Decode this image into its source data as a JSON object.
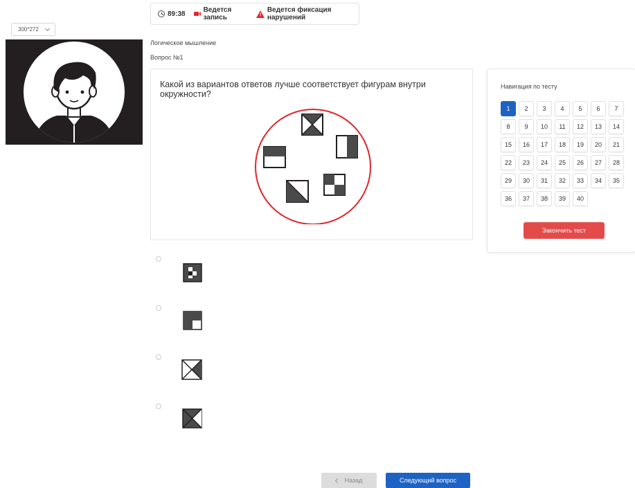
{
  "status_bar": {
    "timer": "89:38",
    "recording_label": "Ведется запись",
    "violation_label": "Ведется фиксация нарушений",
    "icons": [
      "clock-icon",
      "camera-icon",
      "warning-icon"
    ],
    "colors": {
      "alert": "#e5282f"
    }
  },
  "camera": {
    "resolution_value": "300*272"
  },
  "test": {
    "subject": "Логическое мышление",
    "question_number": "Вопрос №1",
    "question_text": "Какой из вариантов ответов лучше соответствует фигурам внутри окружности?"
  },
  "navigation": {
    "title": "Навигация по тесту",
    "questions": [
      "1",
      "2",
      "3",
      "4",
      "5",
      "6",
      "7",
      "8",
      "9",
      "10",
      "11",
      "12",
      "13",
      "14",
      "15",
      "16",
      "17",
      "18",
      "19",
      "20",
      "21",
      "22",
      "23",
      "24",
      "25",
      "26",
      "27",
      "28",
      "29",
      "30",
      "31",
      "32",
      "33",
      "34",
      "35",
      "36",
      "37",
      "38",
      "39",
      "40"
    ],
    "active": "1",
    "finish_label": "Закончить тест",
    "colors": {
      "active": "#1e63c4",
      "finish": "#e34b4b"
    }
  },
  "options_count": 4,
  "footer": {
    "back_label": "Назад",
    "next_label": "Следующий вопрос",
    "colors": {
      "next": "#1e63c4",
      "back": "#dcdcdc"
    }
  }
}
